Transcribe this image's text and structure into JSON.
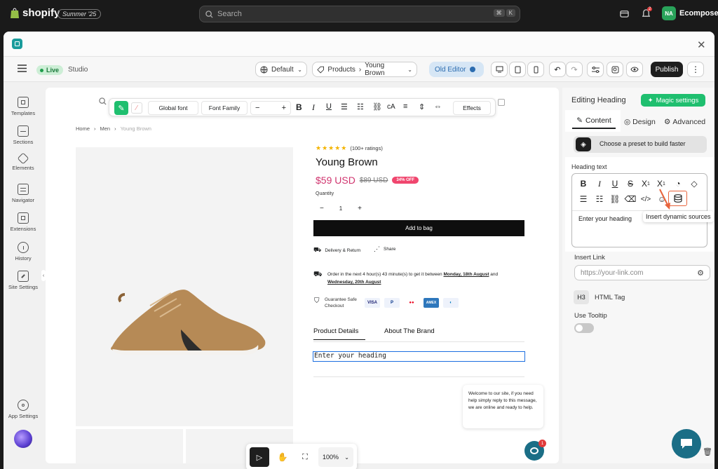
{
  "shopify": {
    "brand": "shopify",
    "edition": "Summer '25",
    "search_placeholder": "Search",
    "kbd1": "⌘",
    "kbd2": "K",
    "notif_count": "2",
    "avatar": "NA",
    "account": "Ecomposer"
  },
  "header": {
    "live": "Live",
    "studio": "Studio",
    "language": "Default",
    "breadcrumb_1": "Products",
    "breadcrumb_2": "Young Brown",
    "old_editor": "Old Editor",
    "publish": "Publish"
  },
  "rail": {
    "items": [
      {
        "label": "Templates"
      },
      {
        "label": "Sections"
      },
      {
        "label": "Elements"
      },
      {
        "label": "Navigator"
      },
      {
        "label": "Extensions"
      },
      {
        "label": "History"
      },
      {
        "label": "Site Settings"
      },
      {
        "label": "App Settings"
      }
    ]
  },
  "floattoolbar": {
    "global_font": "Global font",
    "font_family": "Font Family",
    "minus": "−",
    "plus": "+",
    "effects": "Effects"
  },
  "product": {
    "crumbs": [
      "Home",
      "Men",
      "Young Brown"
    ],
    "ratings": "(100+ ratings)",
    "title": "Young Brown",
    "price": "$59 USD",
    "compare": "$89 USD",
    "discount": "34% OFF",
    "quantity_label": "Quantity",
    "qty": "1",
    "qty_minus": "−",
    "qty_plus": "+",
    "add_to_bag": "Add to bag",
    "delivery": "Delivery & Return",
    "share": "Share",
    "order_text": "Order in the next 4 hour(s) 43 minute(s) to get it between ",
    "date1": "Monday, 18th August",
    "and": " and ",
    "date2": "Wednesday, 20th August",
    "guarantee": "Guarantee Safe Checkout",
    "payments": [
      "VISA",
      "P",
      "●●",
      "AMEX",
      "◐"
    ],
    "tab1": "Product Details",
    "tab2": "About The Brand",
    "heading_placeholder": "Enter your heading"
  },
  "chat": {
    "message": "Welcome to our site, if you need help simply reply to this message, we are online and ready to help.",
    "badge": "1"
  },
  "bottombar": {
    "zoom": "100%"
  },
  "panel": {
    "title": "Editing Heading",
    "magic": "Magic settings",
    "tab_content": "Content",
    "tab_design": "Design",
    "tab_advanced": "Advanced",
    "preset": "Choose a preset to build faster",
    "heading_text_label": "Heading text",
    "editor_placeholder": "Enter your heading",
    "tooltip": "Insert dynamic sources",
    "insert_link": "Insert Link",
    "link_placeholder": "https://your-link.com",
    "h3": "H3",
    "html_tag": "HTML Tag",
    "use_tooltip": "Use Tooltip"
  },
  "colors": {
    "accent": "#e8643c",
    "magic": "#1fbf6f",
    "price": "#d0356f",
    "badge": "#f0466e",
    "black": "#0e0e0e"
  }
}
